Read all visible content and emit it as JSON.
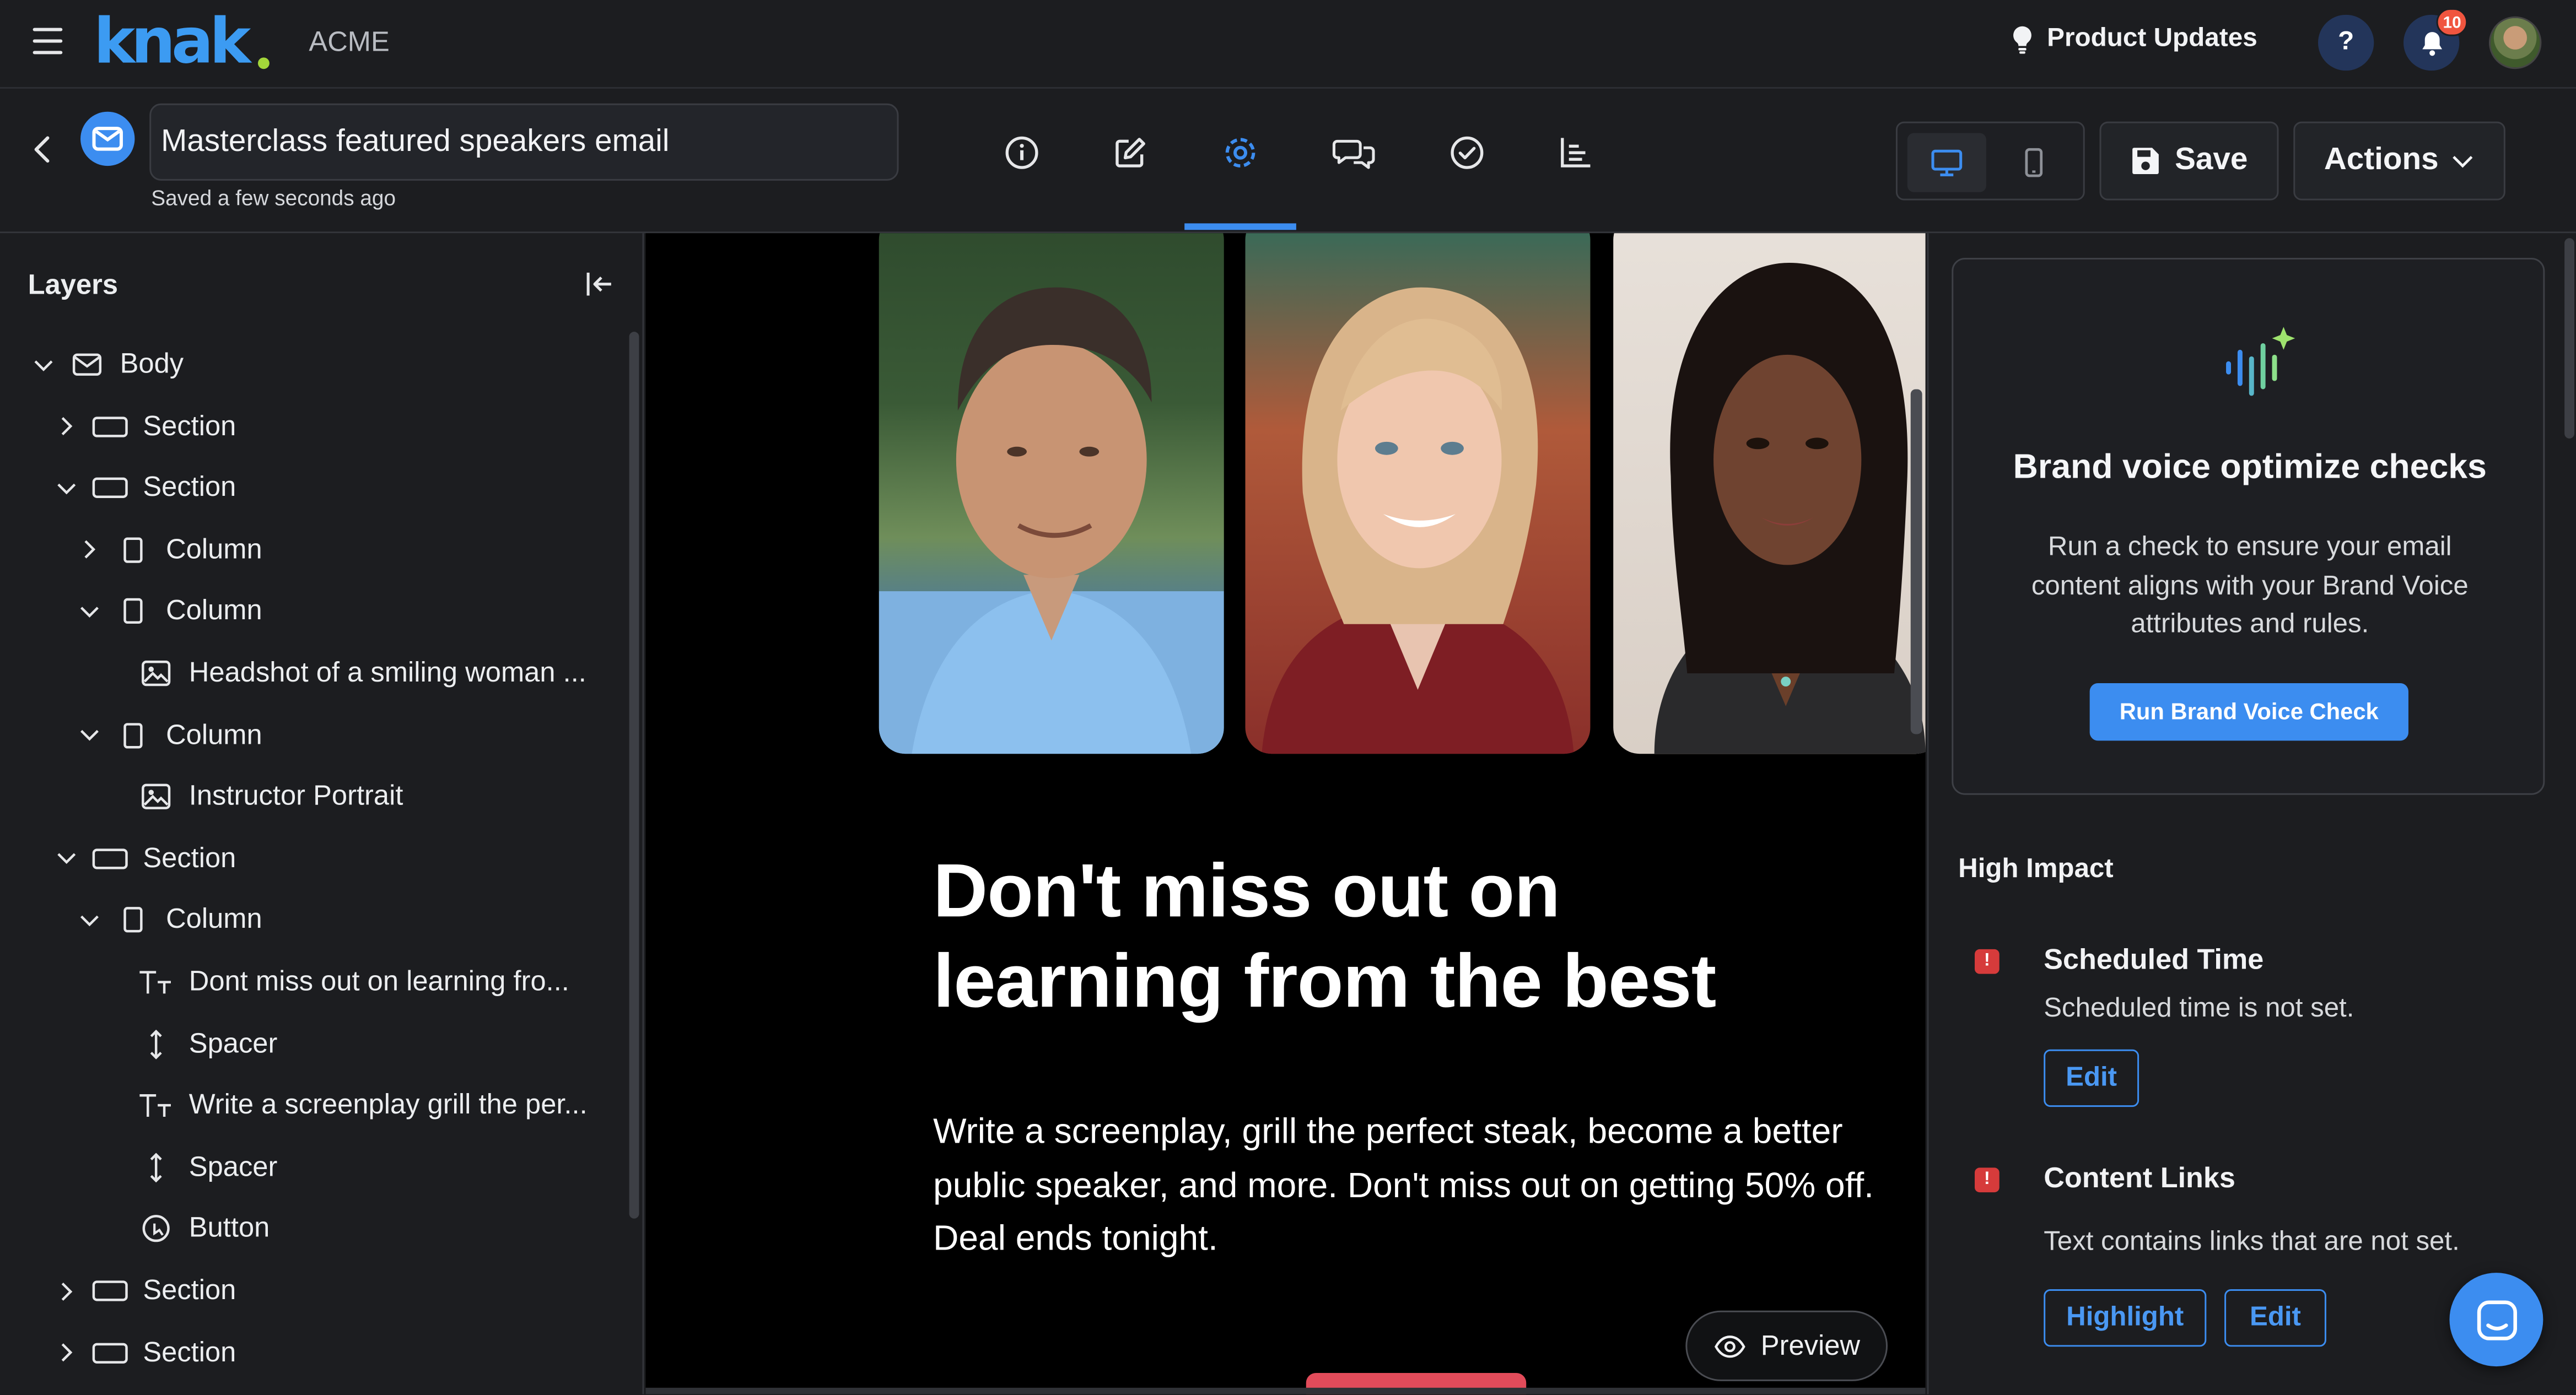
{
  "brand": {
    "logo_text": "knak",
    "org_name": "ACME",
    "accent": "#3c8df0",
    "logo_color": "#3c9bf2",
    "logo_dot_color": "#a3d63a"
  },
  "topbar": {
    "product_updates": "Product Updates",
    "help": "?",
    "notification_count": "10"
  },
  "editor": {
    "email_name": "Masterclass featured speakers email",
    "saved_status": "Saved a few seconds ago",
    "mode_tabs": [
      "info-icon",
      "edit-icon",
      "settings-icon",
      "comments-icon",
      "check-icon",
      "chart-icon"
    ],
    "active_mode": "settings-icon",
    "device": "desktop",
    "save_label": "Save",
    "actions_label": "Actions"
  },
  "layers": {
    "title": "Layers",
    "items": [
      {
        "label": "Body",
        "icon": "envelope-icon",
        "expanded": true
      },
      {
        "label": "Section",
        "icon": "section-icon",
        "expanded": false
      },
      {
        "label": "Section",
        "icon": "section-icon",
        "expanded": true
      },
      {
        "label": "Column",
        "icon": "column-icon",
        "expanded": false
      },
      {
        "label": "Column",
        "icon": "column-icon",
        "expanded": true
      },
      {
        "label": "Headshot of a smiling woman ...",
        "icon": "image-icon"
      },
      {
        "label": "Column",
        "icon": "column-icon",
        "expanded": true
      },
      {
        "label": "Instructor Portrait",
        "icon": "image-icon"
      },
      {
        "label": "Section",
        "icon": "section-icon",
        "expanded": true
      },
      {
        "label": "Column",
        "icon": "column-icon",
        "expanded": true
      },
      {
        "label": "Dont miss out on learning fro...",
        "icon": "text-icon"
      },
      {
        "label": "Spacer",
        "icon": "spacer-icon"
      },
      {
        "label": "Write a screenplay grill the per...",
        "icon": "text-icon"
      },
      {
        "label": "Spacer",
        "icon": "spacer-icon"
      },
      {
        "label": "Button",
        "icon": "button-icon"
      },
      {
        "label": "Section",
        "icon": "section-icon",
        "expanded": false
      },
      {
        "label": "Section",
        "icon": "section-icon",
        "expanded": false
      }
    ]
  },
  "canvas": {
    "headline": "Don't miss out on learning from the best",
    "body": "Write a screenplay, grill the perfect steak, become a better public speaker, and more. Don't miss out on getting 50% off. Deal ends tonight.",
    "preview_label": "Preview"
  },
  "brand_voice": {
    "title": "Brand voice optimize checks",
    "description": "Run a check to ensure your email content aligns with your Brand Voice attributes and rules.",
    "button": "Run Brand Voice Check"
  },
  "checks": {
    "section_title": "High Impact",
    "issues": [
      {
        "title": "Scheduled Time",
        "description": "Scheduled time is not set.",
        "actions": [
          "Edit"
        ]
      },
      {
        "title": "Content Links",
        "description": "Text contains links that are not set.",
        "actions": [
          "Highlight",
          "Edit"
        ]
      }
    ],
    "error_color": "#d63b3b"
  }
}
